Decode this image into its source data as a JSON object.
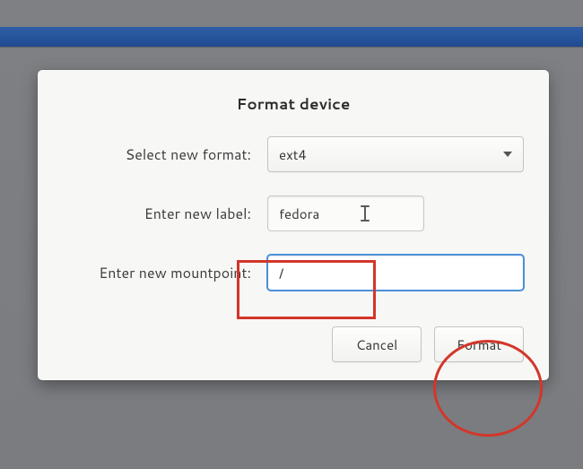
{
  "dialog": {
    "title": "Format device",
    "fields": {
      "format": {
        "label": "Select new format:",
        "value": "ext4"
      },
      "label": {
        "label": "Enter new label:",
        "value": "fedora"
      },
      "mountpoint": {
        "label": "Enter new mountpoint:",
        "value": "/"
      }
    },
    "buttons": {
      "cancel": "Cancel",
      "format": "Format"
    }
  }
}
